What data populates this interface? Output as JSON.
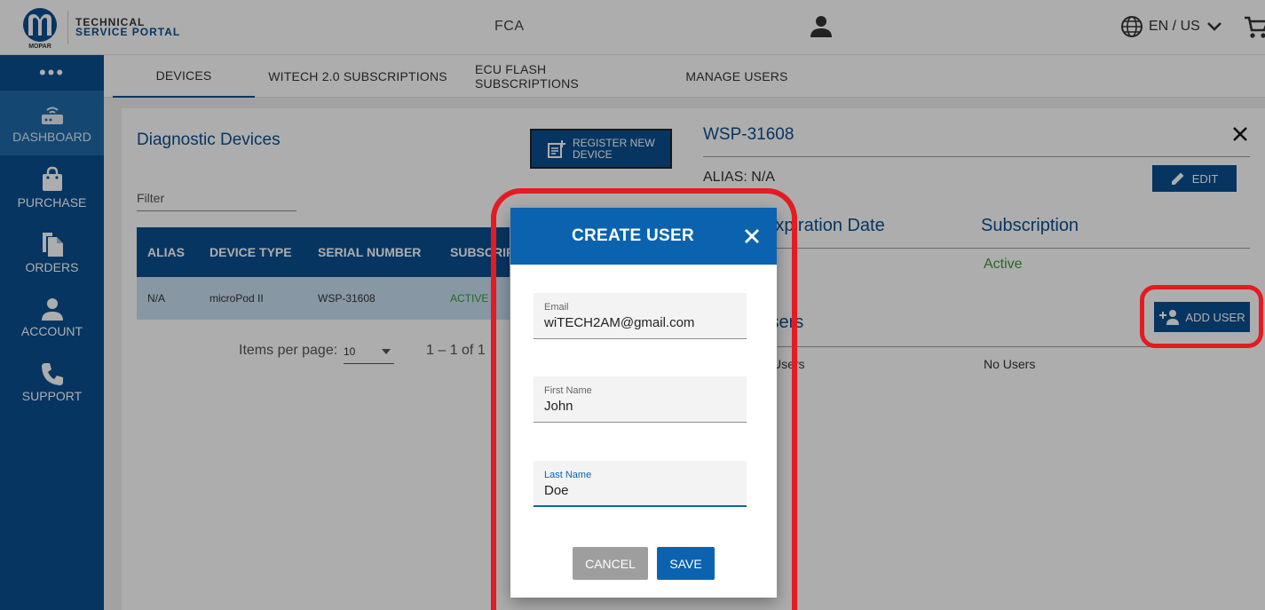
{
  "header": {
    "brand_line1": "TECHNICAL",
    "brand_line2": "SERVICE PORTAL",
    "logo_text": "MOPAR",
    "org": "FCA",
    "language": "EN / US"
  },
  "sidebar": {
    "items": [
      {
        "label": "DASHBOARD",
        "icon": "router-icon"
      },
      {
        "label": "PURCHASE",
        "icon": "shopping-bag-icon"
      },
      {
        "label": "ORDERS",
        "icon": "document-icon"
      },
      {
        "label": "ACCOUNT",
        "icon": "person-icon"
      },
      {
        "label": "SUPPORT",
        "icon": "phone-icon"
      }
    ]
  },
  "tabs": [
    "DEVICES",
    "WITECH 2.0 SUBSCRIPTIONS",
    "ECU FLASH SUBSCRIPTIONS",
    "MANAGE USERS"
  ],
  "devices": {
    "title": "Diagnostic Devices",
    "register_label": "REGISTER NEW DEVICE",
    "filter_placeholder": "Filter",
    "columns": [
      "ALIAS",
      "DEVICE TYPE",
      "SERIAL NUMBER",
      "SUBSCRIPTION"
    ],
    "rows": [
      {
        "alias": "N/A",
        "device_type": "microPod II",
        "serial": "WSP-31608",
        "subscription": "ACTIVE"
      }
    ],
    "items_per_page_label": "Items per page:",
    "items_per_page": "10",
    "range": "1 – 1 of 1"
  },
  "detail": {
    "title": "WSP-31608",
    "alias_label": "ALIAS:",
    "alias_value": "N/A",
    "edit_label": "EDIT",
    "col_expiration": "Expiration Date",
    "col_subscription": "Subscription",
    "subscription_status": "Active",
    "users_title": "Users",
    "users_col_label": "Users",
    "users_value": "No Users",
    "add_user_label": "ADD USER"
  },
  "dialog": {
    "title": "CREATE USER",
    "fields": [
      {
        "label": "Email",
        "value": "wiTECH2AM@gmail.com"
      },
      {
        "label": "First Name",
        "value": "John"
      },
      {
        "label": "Last Name",
        "value": "Doe"
      }
    ],
    "cancel_label": "CANCEL",
    "save_label": "SAVE"
  },
  "colors": {
    "brand_blue": "#0b4f8f",
    "dialog_blue": "#0b63b0",
    "highlight_red": "#e31b23",
    "status_green": "#3a9a3a"
  }
}
